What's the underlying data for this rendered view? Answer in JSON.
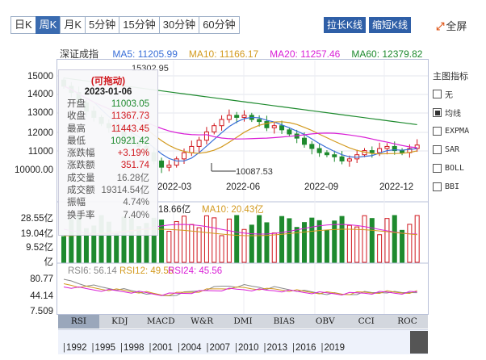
{
  "tabs": [
    {
      "label": "日K",
      "active": false
    },
    {
      "label": "周K",
      "active": true
    },
    {
      "label": "月K",
      "active": false
    },
    {
      "label": "5分钟",
      "active": false
    },
    {
      "label": "15分钟",
      "active": false
    },
    {
      "label": "30分钟",
      "active": false
    },
    {
      "label": "60分钟",
      "active": false
    }
  ],
  "toolbar": {
    "stretch_label": "拉长K线",
    "shorten_label": "缩短K线",
    "fullscreen_label": "全屏"
  },
  "ma": {
    "name": "深证成指",
    "items": [
      {
        "label": "MA5: 11205.99",
        "color": "#3a6fd8"
      },
      {
        "label": "MA10: 11166.17",
        "color": "#d39a1f"
      },
      {
        "label": "MA20: 11257.46",
        "color": "#d91ed6"
      },
      {
        "label": "MA60: 12379.82",
        "color": "#1e8a2e"
      }
    ]
  },
  "price_axis": [
    "15000",
    "14000",
    "13000",
    "12000",
    "11000",
    "10000.00"
  ],
  "top_marker": "15302.95",
  "date_labels": [
    "2022-03",
    "2022-06",
    "2022-09",
    "2022-12"
  ],
  "low_marker": "10087.53",
  "popup": {
    "title": "(可拖动)",
    "date": "2023-01-06",
    "rows": [
      {
        "label": "开盘",
        "value": "11003.05",
        "color": "#1e8a2e"
      },
      {
        "label": "收盘",
        "value": "11367.73",
        "color": "#d0161c"
      },
      {
        "label": "最高",
        "value": "11443.45",
        "color": "#d0161c"
      },
      {
        "label": "最低",
        "value": "10921.42",
        "color": "#1e8a2e"
      },
      {
        "label": "涨跌幅",
        "value": "+3.19%",
        "color": "#d0161c"
      },
      {
        "label": "涨跌额",
        "value": "351.74",
        "color": "#d0161c"
      },
      {
        "label": "成交量",
        "value": "16.28亿",
        "color": "#666"
      },
      {
        "label": "成交额",
        "value": "19314.54亿",
        "color": "#666"
      },
      {
        "label": "振幅",
        "value": "4.74%",
        "color": "#666"
      },
      {
        "label": "换手率",
        "value": "7.40%",
        "color": "#666"
      }
    ]
  },
  "volume": {
    "header_vol": "18.66亿",
    "header_ma10": "MA10: 20.43亿",
    "axis": [
      "28.55亿",
      "19.04亿",
      "9.52亿",
      "亿"
    ]
  },
  "rsi": {
    "items": [
      {
        "label": "RSI6: 56.14",
        "color": "#888"
      },
      {
        "label": "RSI12: 49.55",
        "color": "#d39a1f"
      },
      {
        "label": "RSI24: 45.56",
        "color": "#d91ed6"
      }
    ],
    "axis": [
      "80.77",
      "44.14",
      "7.509"
    ]
  },
  "indicator_tabs": [
    {
      "label": "RSI",
      "active": true
    },
    {
      "label": "KDJ",
      "active": false
    },
    {
      "label": "MACD",
      "active": false
    },
    {
      "label": "W&R",
      "active": false
    },
    {
      "label": "DMI",
      "active": false
    },
    {
      "label": "BIAS",
      "active": false
    },
    {
      "label": "OBV",
      "active": false
    },
    {
      "label": "CCI",
      "active": false
    },
    {
      "label": "ROC",
      "active": false
    }
  ],
  "years": [
    "1992",
    "1995",
    "1998",
    "2001",
    "2004",
    "2007",
    "2010",
    "2013",
    "2016",
    "2019"
  ],
  "sidebar": {
    "title": "主图指标",
    "options": [
      {
        "label": "无",
        "checked": false
      },
      {
        "label": "均线",
        "checked": true
      },
      {
        "label": "EXPMA",
        "checked": false
      },
      {
        "label": "SAR",
        "checked": false
      },
      {
        "label": "BOLL",
        "checked": false
      },
      {
        "label": "BBI",
        "checked": false
      }
    ]
  },
  "chart_data": {
    "type": "candlestick",
    "title": "深证成指",
    "period": "weekly",
    "y_range": [
      9800,
      15400
    ],
    "dates_shown": [
      "2022-03",
      "2022-06",
      "2022-09",
      "2022-12"
    ],
    "closes_approx": [
      14200,
      13900,
      13400,
      13000,
      12700,
      12400,
      12200,
      12000,
      11800,
      11500,
      11300,
      11000,
      10600,
      10300,
      10400,
      10700,
      11000,
      11300,
      11600,
      12000,
      12300,
      12600,
      12800,
      12700,
      12800,
      12600,
      12500,
      12200,
      12300,
      12100,
      11900,
      11700,
      11400,
      11200,
      11000,
      10900,
      10800,
      10600,
      10700,
      10900,
      11100,
      11000,
      11200,
      11300,
      11100,
      11000,
      11200,
      11368
    ],
    "high_label": 15302.95,
    "low_label": 10087.53,
    "ma_latest": {
      "MA5": 11205.99,
      "MA10": 11166.17,
      "MA20": 11257.46,
      "MA60": 12379.82
    }
  }
}
